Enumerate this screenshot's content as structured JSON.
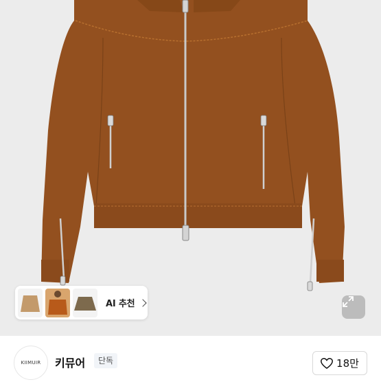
{
  "product": {
    "image_alt": "brown corduroy zip-up jacket",
    "colors": {
      "jacket": "#93501f",
      "background": "#ececec"
    }
  },
  "ai_recommend": {
    "label": "AI 추천",
    "thumbnails": [
      "beige-jacket-thumbnail",
      "orange-jacket-model-thumbnail",
      "olive-jacket-thumbnail"
    ]
  },
  "expand": {
    "icon": "expand-arrows-icon"
  },
  "seller": {
    "avatar_text": "KIIMUIR",
    "name": "키뮤어",
    "badge": "단독"
  },
  "like": {
    "icon": "heart-outline-icon",
    "count": "18만"
  }
}
